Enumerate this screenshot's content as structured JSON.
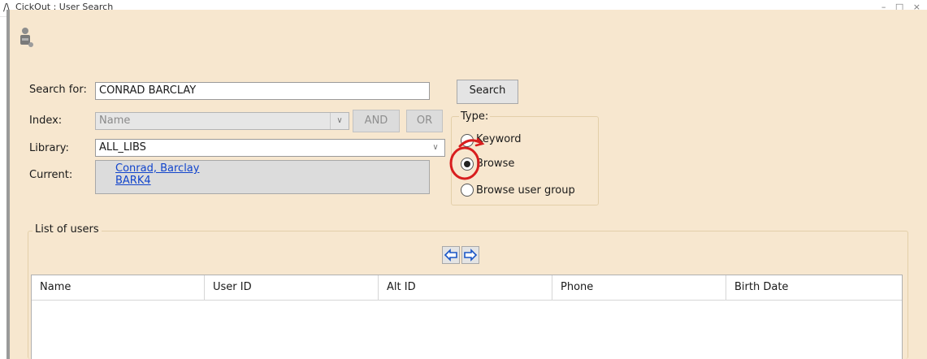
{
  "window": {
    "title_prefix": "C",
    "title_rest": "ickOut : User Search",
    "controls": "– □ ×"
  },
  "search": {
    "label": "Search for:",
    "value": "CONRAD BARCLAY",
    "button": "Search"
  },
  "index": {
    "label": "Index:",
    "value": "Name",
    "and_button": "AND",
    "or_button": "OR"
  },
  "library": {
    "label": "Library:",
    "value": "ALL_LIBS"
  },
  "current": {
    "label": "Current:",
    "name_link": "Conrad, Barclay",
    "id_link": "BARK4"
  },
  "type": {
    "label": "Type:",
    "options": [
      {
        "label": "Keyword",
        "checked": false
      },
      {
        "label": "Browse",
        "checked": true
      },
      {
        "label": "Browse user group",
        "checked": false
      }
    ]
  },
  "users": {
    "group_label": "List of users",
    "columns": [
      "Name",
      "User ID",
      "Alt ID",
      "Phone",
      "Birth Date"
    ],
    "rows": []
  },
  "colors": {
    "panel_bg": "#f7e7cf",
    "link": "#1144cc",
    "annotation": "#d81e1e"
  }
}
